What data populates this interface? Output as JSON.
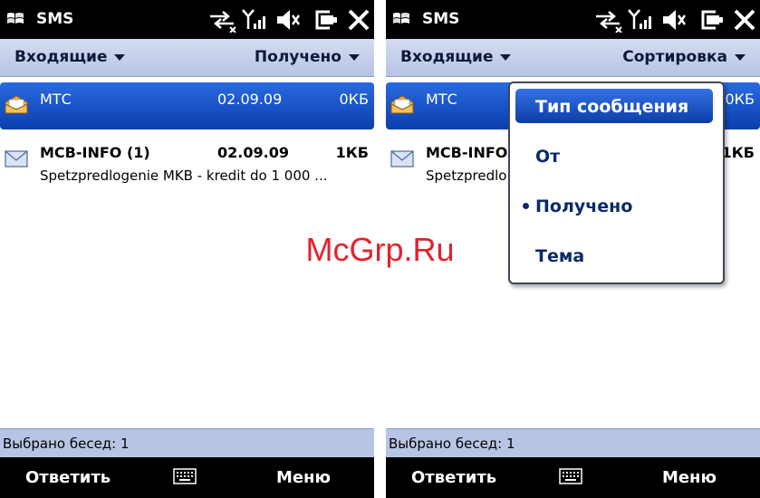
{
  "left": {
    "title": "SMS",
    "tab_left": "Входящие",
    "tab_right": "Получено",
    "messages": [
      {
        "name": "МТС",
        "date": "02.09.09",
        "size": "0КБ",
        "preview": ""
      },
      {
        "name": "MCB-INFO (1)",
        "date": "02.09.09",
        "size": "1КБ",
        "preview": "Spetzpredlogenie  MKB -  kredit do 1 000 ..."
      }
    ],
    "status": "Выбрано бесед: 1",
    "softkey_left": "Ответить",
    "softkey_right": "Меню"
  },
  "right": {
    "title": "SMS",
    "tab_left": "Входящие",
    "tab_right": "Сортировка",
    "messages": [
      {
        "name": "МТС",
        "size": "0КБ"
      },
      {
        "name": "MCB-INFO",
        "size": "1КБ",
        "preview": "Spetzpredlo"
      }
    ],
    "sort_menu": [
      {
        "label": "Тип сообщения",
        "highlighted": true,
        "checked": false
      },
      {
        "label": "От",
        "highlighted": false,
        "checked": false
      },
      {
        "label": "Получено",
        "highlighted": false,
        "checked": true
      },
      {
        "label": "Тема",
        "highlighted": false,
        "checked": false
      }
    ],
    "status": "Выбрано бесед: 1",
    "softkey_left": "Ответить",
    "softkey_right": "Меню"
  },
  "watermark": "McGrp.Ru",
  "icons": {
    "start": "windows-flag-icon",
    "sync": "sync-arrows-icon",
    "signal": "signal-strength-icon",
    "volume": "speaker-mute-icon",
    "battery": "battery-icon",
    "close": "close-icon",
    "keyboard": "keyboard-icon",
    "open_message": "envelope-open-icon",
    "closed_message": "envelope-icon"
  },
  "colors": {
    "selection": "#0b3fae",
    "header_band": "#b8c4e4",
    "watermark": "#e2222a"
  }
}
